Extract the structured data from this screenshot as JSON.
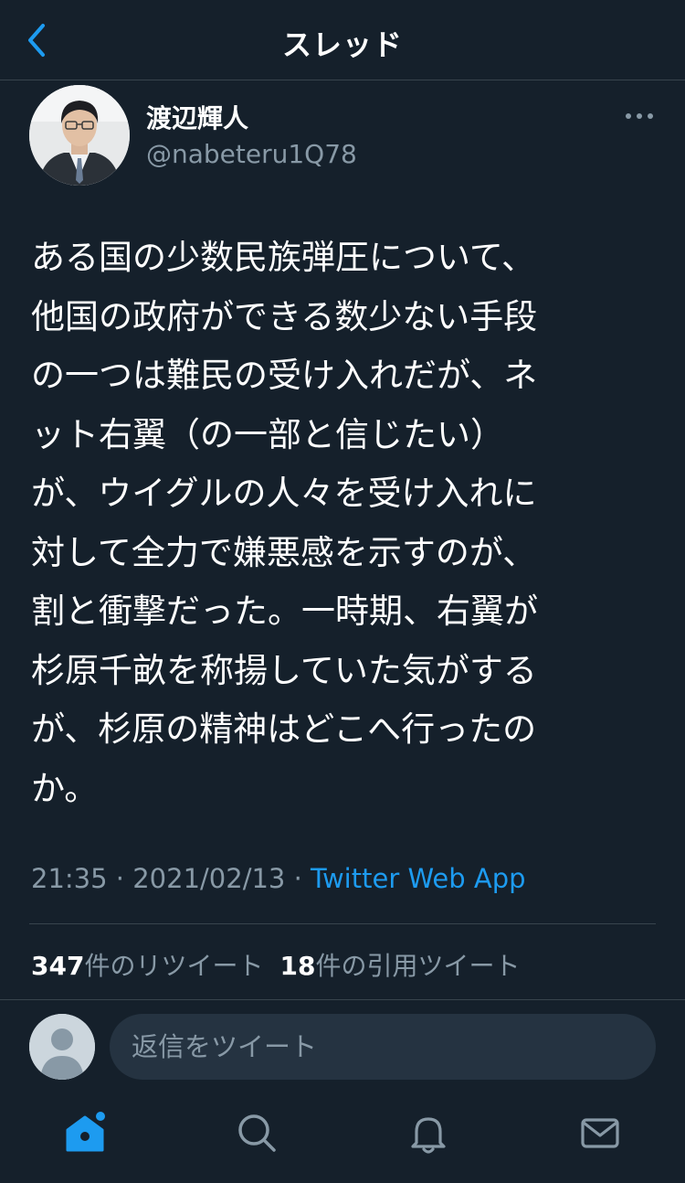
{
  "header": {
    "title": "スレッド",
    "back_icon": "chevron-left-icon"
  },
  "tweet": {
    "author_name": "渡辺輝人",
    "author_handle": "@nabeteru1Q78",
    "text_lines": [
      "ある国の少数民族弾圧について、",
      "他国の政府ができる数少ない手段",
      "の一つは難民の受け入れだが、ネ",
      "ット右翼（の一部と信じたい）",
      "が、ウイグルの人々を受け入れに",
      "対して全力で嫌悪感を示すのが、",
      "割と衝撃だった。一時期、右翼が",
      "杉原千畝を称揚していた気がする",
      "が、杉原の精神はどこへ行ったの",
      "か。"
    ],
    "time": "21:35",
    "separator": "·",
    "date": "2021/02/13",
    "source": "Twitter Web App"
  },
  "stats": {
    "retweets_count": "347",
    "retweets_label": "件のリツイート",
    "quotes_count": "18",
    "quotes_label": "件の引用ツイート"
  },
  "reply": {
    "placeholder": "返信をツイート"
  },
  "tab_bar": {
    "items": [
      "home-icon",
      "search-icon",
      "bell-icon",
      "mail-icon"
    ]
  },
  "colors": {
    "background": "#15202b",
    "accent": "#1d9bf0",
    "secondary_text": "#8899a6",
    "divider": "#38444d"
  }
}
